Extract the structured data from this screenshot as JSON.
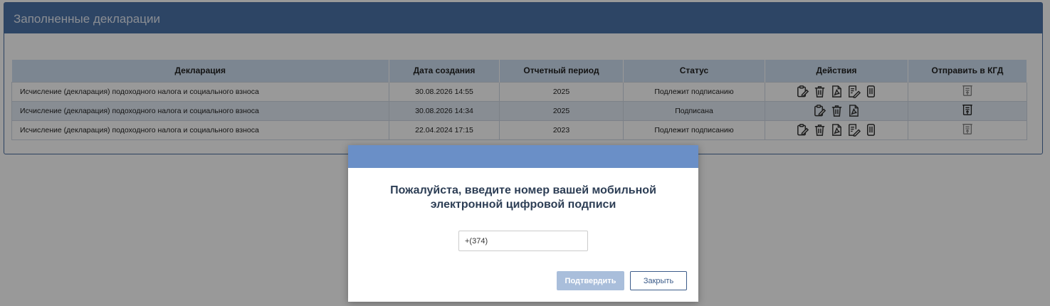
{
  "panel": {
    "title": "Заполненные декларации"
  },
  "table": {
    "headers": {
      "declaration": "Декларация",
      "created": "Дата создания",
      "period": "Отчетный период",
      "status": "Статус",
      "actions": "Действия",
      "send": "Отправить в КГД"
    },
    "rows": [
      {
        "declaration": "Исчисление (декларация) подоходного налога и социального взноса",
        "created": "30.08.2026 14:55",
        "period": "2025",
        "status": "Подлежит подписанию",
        "actions": [
          "clipboard-edit-icon",
          "trash-icon",
          "pdf-icon",
          "sign-document-icon",
          "paperclip-icon"
        ],
        "send_icon": "send-document-icon"
      },
      {
        "declaration": "Исчисление (декларация) подоходного налога и социального взноса",
        "created": "30.08.2026 14:34",
        "period": "2025",
        "status": "Подписана",
        "actions": [
          "clipboard-edit-icon",
          "trash-icon",
          "pdf-icon"
        ],
        "send_icon": "send-document-icon"
      },
      {
        "declaration": "Исчисление (декларация) подоходного налога и социального взноса",
        "created": "22.04.2024 17:15",
        "period": "2023",
        "status": "Подлежит подписанию",
        "actions": [
          "clipboard-edit-icon",
          "trash-icon",
          "pdf-icon",
          "sign-document-icon",
          "paperclip-icon"
        ],
        "send_icon": "send-document-icon"
      }
    ]
  },
  "modal": {
    "title_line1": "Пожалуйста, введите номер вашей мобильной",
    "title_line2": "электронной цифровой подписи",
    "phone_value": "+(374)",
    "confirm_label": "Подтвердить",
    "close_label": "Закрыть"
  },
  "colors": {
    "header_bar": "#4b73a8",
    "modal_header": "#6a8fc7",
    "table_header": "#cfe0f2",
    "confirm_button": "#a9bedb"
  }
}
